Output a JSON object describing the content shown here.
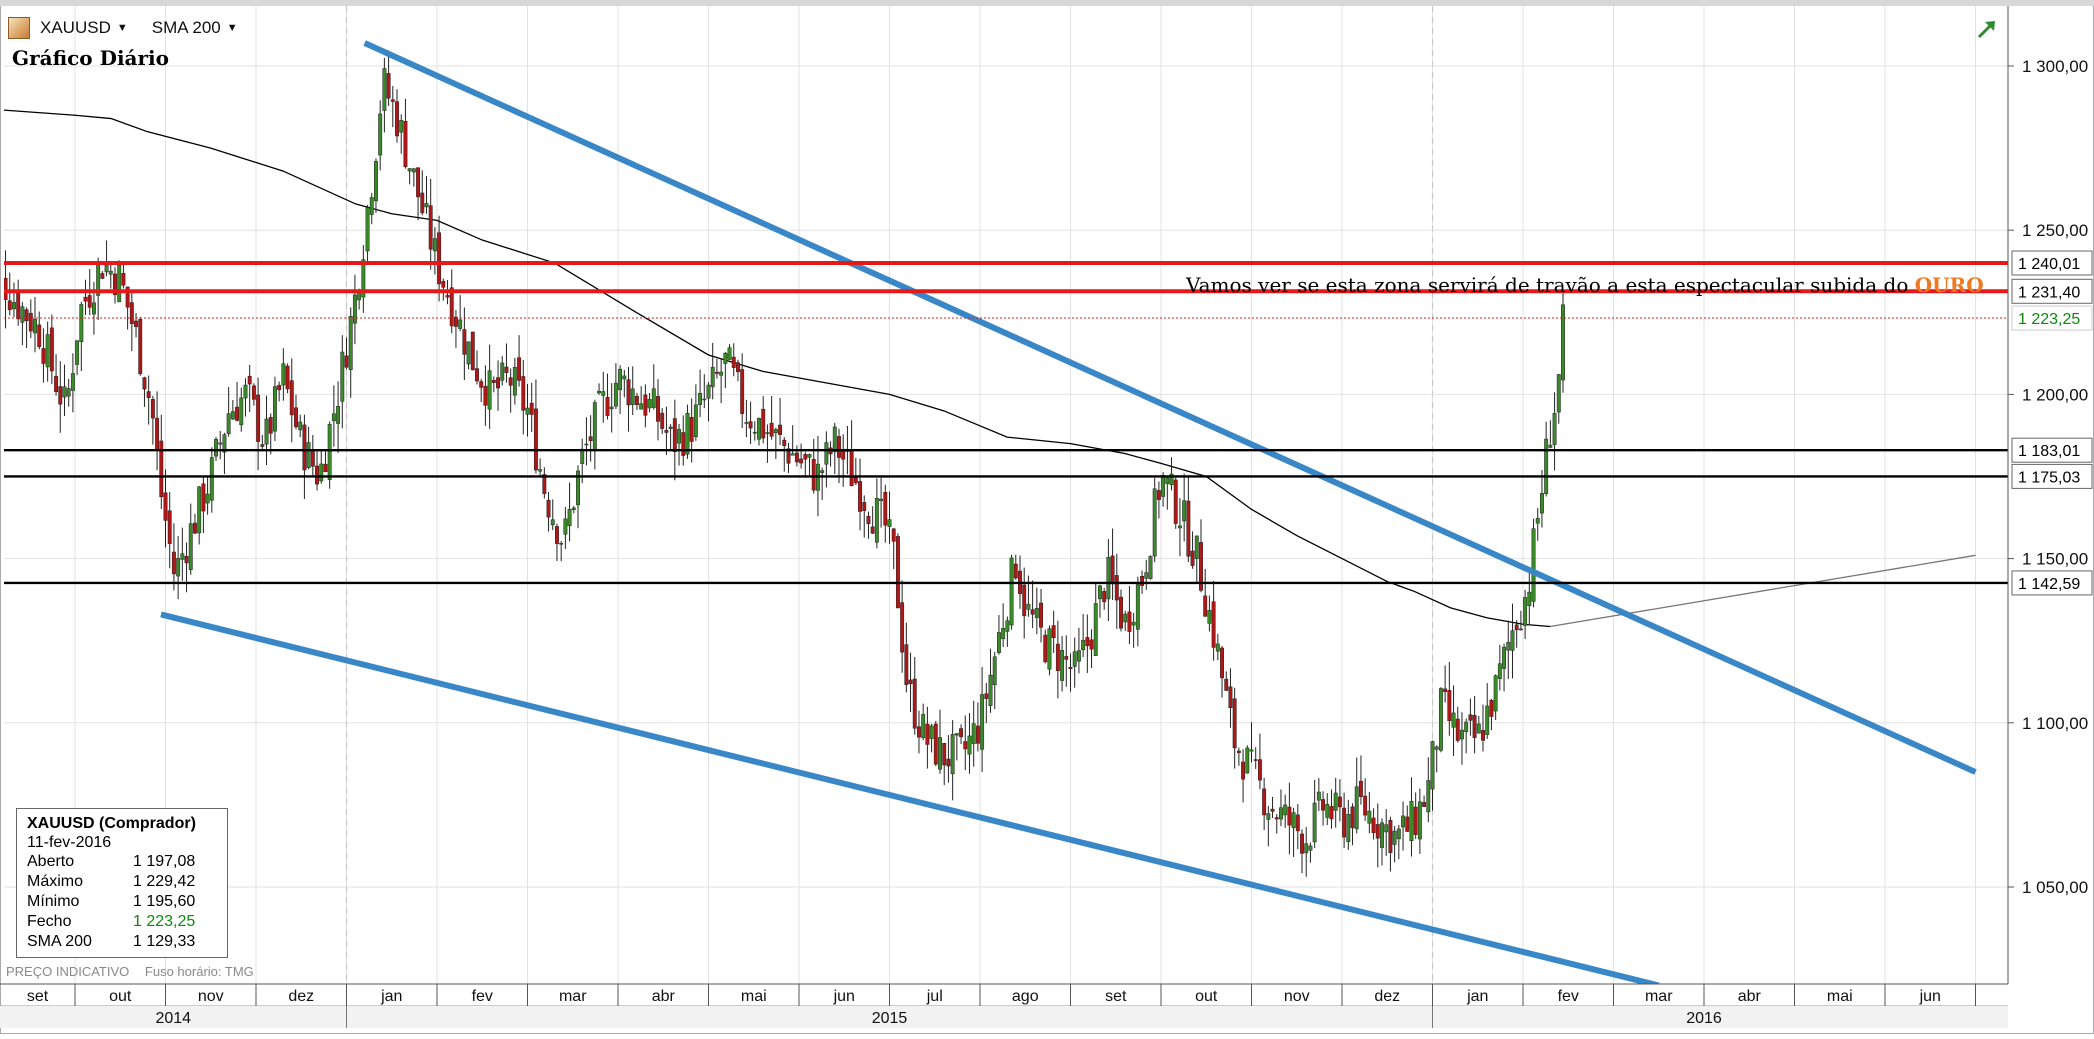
{
  "toolbar": {
    "symbol": "XAUUSD",
    "indicator": "SMA 200"
  },
  "chart_title": "Gráfico Diário",
  "info": {
    "title": "XAUUSD (Comprador)",
    "date": "11-fev-2016",
    "rows": [
      {
        "label": "Aberto",
        "value": "1 197,08"
      },
      {
        "label": "Máximo",
        "value": "1 229,42"
      },
      {
        "label": "Mínimo",
        "value": "1 195,60"
      },
      {
        "label": "Fecho",
        "value": "1 223,25"
      },
      {
        "label": "SMA 200",
        "value": "1 129,33"
      }
    ]
  },
  "footnote": {
    "price_note": "PREÇO INDICATIVO",
    "timezone": "Fuso horário: TMG"
  },
  "annotation": {
    "text_prefix": "Vamos ver se esta zona servirá de travão a esta espectacular subida do ",
    "text_highlight": "OURO"
  },
  "colors": {
    "up": "#3a8a2a",
    "down": "#b01818",
    "channel": "#3a87c8",
    "resistance": "#e41a1a",
    "support": "#000000",
    "sma": "#000000",
    "highlight": "#f07820",
    "last_price": "#0a8a0a"
  },
  "chart_data": {
    "type": "candlestick",
    "title": "Gráfico Diário",
    "symbol": "XAUUSD",
    "ylim": [
      1020,
      1330
    ],
    "y_ticks": [
      1050,
      1100,
      1150,
      1200,
      1250,
      1300
    ],
    "y_tick_labels": [
      "1 050,00",
      "1 100,00",
      "1 150,00",
      "1 200,00",
      "1 250,00",
      "1 300,00"
    ],
    "months": [
      "set",
      "out",
      "nov",
      "dez",
      "jan",
      "fev",
      "mar",
      "abr",
      "mai",
      "jun",
      "jul",
      "ago",
      "set",
      "out",
      "nov",
      "dez",
      "jan",
      "fev",
      "mar",
      "abr",
      "mai",
      "jun"
    ],
    "years": [
      {
        "label": "2014",
        "start_month": 0,
        "end_month": 4
      },
      {
        "label": "2015",
        "start_month": 4,
        "end_month": 16
      },
      {
        "label": "2016",
        "start_month": 16,
        "end_month": 22
      }
    ],
    "horizontal_levels": [
      {
        "value": 1240.01,
        "label": "1 240,01",
        "kind": "resistance"
      },
      {
        "value": 1231.4,
        "label": "1 231,40",
        "kind": "resistance"
      },
      {
        "value": 1223.25,
        "label": "1 223,25",
        "kind": "last"
      },
      {
        "value": 1183.01,
        "label": "1 183,01",
        "kind": "support"
      },
      {
        "value": 1175.03,
        "label": "1 175,03",
        "kind": "support"
      },
      {
        "value": 1142.59,
        "label": "1 142,59",
        "kind": "support"
      }
    ],
    "price_path": [
      [
        0.0,
        1245
      ],
      [
        0.3,
        1230
      ],
      [
        0.6,
        1220
      ],
      [
        0.9,
        1195
      ],
      [
        1.05,
        1225
      ],
      [
        1.3,
        1240
      ],
      [
        1.5,
        1235
      ],
      [
        1.7,
        1215
      ],
      [
        1.85,
        1195
      ],
      [
        1.95,
        1170
      ],
      [
        2.1,
        1145
      ],
      [
        2.3,
        1160
      ],
      [
        2.5,
        1175
      ],
      [
        2.7,
        1195
      ],
      [
        2.9,
        1200
      ],
      [
        3.1,
        1185
      ],
      [
        3.3,
        1205
      ],
      [
        3.5,
        1185
      ],
      [
        3.7,
        1175
      ],
      [
        3.9,
        1200
      ],
      [
        4.1,
        1230
      ],
      [
        4.3,
        1270
      ],
      [
        4.4,
        1295
      ],
      [
        4.55,
        1285
      ],
      [
        4.7,
        1270
      ],
      [
        4.85,
        1255
      ],
      [
        5.0,
        1240
      ],
      [
        5.2,
        1225
      ],
      [
        5.4,
        1210
      ],
      [
        5.6,
        1200
      ],
      [
        5.8,
        1205
      ],
      [
        6.0,
        1195
      ],
      [
        6.2,
        1170
      ],
      [
        6.4,
        1155
      ],
      [
        6.6,
        1180
      ],
      [
        6.8,
        1195
      ],
      [
        7.0,
        1205
      ],
      [
        7.2,
        1200
      ],
      [
        7.4,
        1195
      ],
      [
        7.6,
        1185
      ],
      [
        7.8,
        1190
      ],
      [
        8.0,
        1200
      ],
      [
        8.2,
        1210
      ],
      [
        8.4,
        1195
      ],
      [
        8.6,
        1190
      ],
      [
        8.8,
        1185
      ],
      [
        9.0,
        1180
      ],
      [
        9.2,
        1175
      ],
      [
        9.4,
        1185
      ],
      [
        9.6,
        1175
      ],
      [
        9.8,
        1165
      ],
      [
        9.95,
        1160
      ],
      [
        10.05,
        1150
      ],
      [
        10.2,
        1110
      ],
      [
        10.4,
        1095
      ],
      [
        10.6,
        1090
      ],
      [
        10.8,
        1090
      ],
      [
        11.0,
        1100
      ],
      [
        11.2,
        1125
      ],
      [
        11.4,
        1150
      ],
      [
        11.5,
        1135
      ],
      [
        11.7,
        1125
      ],
      [
        11.9,
        1120
      ],
      [
        12.05,
        1115
      ],
      [
        12.2,
        1125
      ],
      [
        12.4,
        1145
      ],
      [
        12.6,
        1130
      ],
      [
        12.8,
        1145
      ],
      [
        13.0,
        1175
      ],
      [
        13.2,
        1165
      ],
      [
        13.4,
        1150
      ],
      [
        13.6,
        1125
      ],
      [
        13.8,
        1095
      ],
      [
        14.0,
        1085
      ],
      [
        14.2,
        1075
      ],
      [
        14.4,
        1070
      ],
      [
        14.6,
        1065
      ],
      [
        14.8,
        1075
      ],
      [
        15.0,
        1070
      ],
      [
        15.2,
        1075
      ],
      [
        15.4,
        1070
      ],
      [
        15.6,
        1065
      ],
      [
        15.8,
        1070
      ],
      [
        15.95,
        1080
      ],
      [
        16.1,
        1105
      ],
      [
        16.3,
        1095
      ],
      [
        16.5,
        1095
      ],
      [
        16.7,
        1110
      ],
      [
        16.9,
        1130
      ],
      [
        17.05,
        1140
      ],
      [
        17.2,
        1170
      ],
      [
        17.3,
        1190
      ],
      [
        17.38,
        1200
      ],
      [
        17.45,
        1223
      ]
    ],
    "sma_path": [
      [
        0.0,
        1287
      ],
      [
        1.0,
        1285
      ],
      [
        1.4,
        1284
      ],
      [
        1.8,
        1280
      ],
      [
        2.5,
        1275
      ],
      [
        3.3,
        1268
      ],
      [
        4.1,
        1258
      ],
      [
        4.5,
        1255
      ],
      [
        5.0,
        1253
      ],
      [
        5.5,
        1247
      ],
      [
        6.3,
        1240
      ],
      [
        7.2,
        1225
      ],
      [
        8.0,
        1212
      ],
      [
        8.6,
        1207
      ],
      [
        9.2,
        1204
      ],
      [
        10.0,
        1200
      ],
      [
        10.6,
        1195
      ],
      [
        11.3,
        1187
      ],
      [
        12.0,
        1185
      ],
      [
        12.6,
        1182
      ],
      [
        13.0,
        1179
      ],
      [
        13.5,
        1175
      ],
      [
        14.0,
        1165
      ],
      [
        14.5,
        1157
      ],
      [
        15.0,
        1150
      ],
      [
        15.5,
        1143
      ],
      [
        15.8,
        1140
      ],
      [
        16.2,
        1135
      ],
      [
        16.6,
        1132
      ],
      [
        17.0,
        1130
      ],
      [
        17.3,
        1129.33
      ]
    ],
    "sma_projection": [
      [
        17.3,
        1129.33
      ],
      [
        22.0,
        1151
      ]
    ],
    "channel_upper": [
      [
        4.2,
        1307
      ],
      [
        22.0,
        1085
      ]
    ],
    "channel_lower": [
      [
        1.95,
        1133
      ],
      [
        18.5,
        1020
      ]
    ]
  }
}
